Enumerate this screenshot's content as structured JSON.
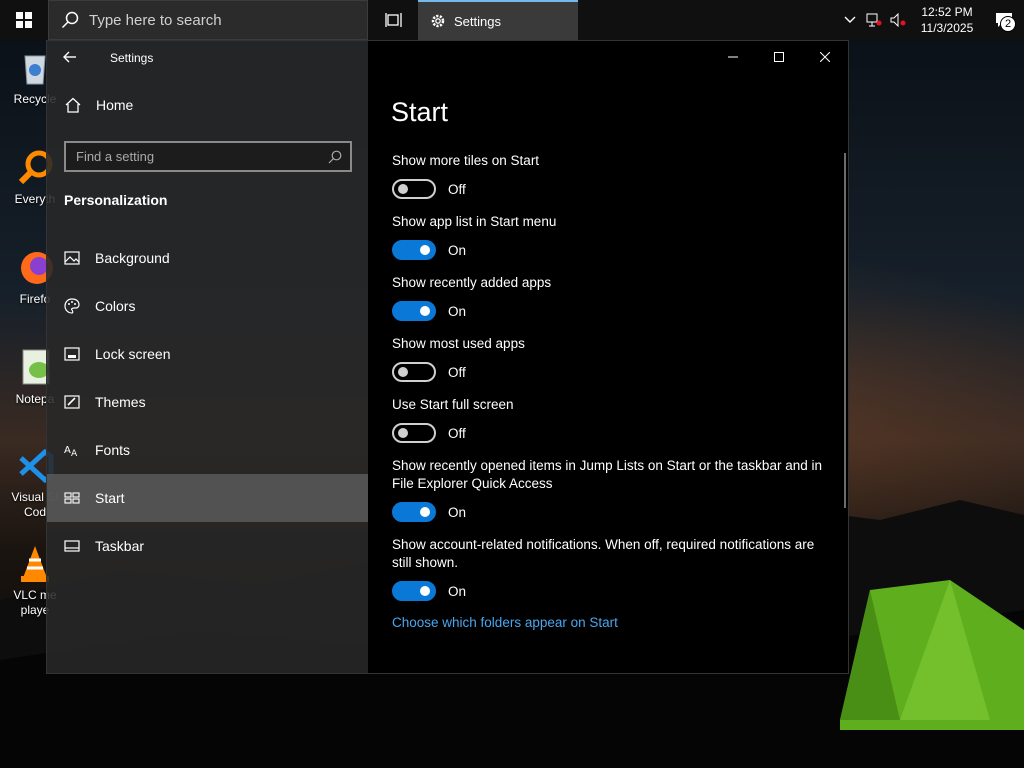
{
  "taskbar": {
    "search_placeholder": "Type here to search",
    "active_app": "Settings",
    "clock_time": "12:52 PM",
    "clock_date": "11/3/2025",
    "notification_count": "2"
  },
  "desktop_icons": [
    {
      "label": "Recycle",
      "icon": "recycle-bin-icon"
    },
    {
      "label": "Everyth",
      "icon": "everything-search-icon"
    },
    {
      "label": "Firefo",
      "icon": "firefox-icon"
    },
    {
      "label": "Notepa",
      "icon": "notepad-plus-plus-icon"
    },
    {
      "label": "Visual St",
      "label2": "Cod",
      "icon": "vscode-icon"
    },
    {
      "label": "VLC me",
      "label2": "playe",
      "icon": "vlc-icon"
    }
  ],
  "window": {
    "title": "Settings",
    "sidebar": {
      "home_label": "Home",
      "find_placeholder": "Find a setting",
      "section": "Personalization",
      "items": [
        {
          "label": "Background",
          "icon": "picture-icon"
        },
        {
          "label": "Colors",
          "icon": "palette-icon"
        },
        {
          "label": "Lock screen",
          "icon": "lock-screen-icon"
        },
        {
          "label": "Themes",
          "icon": "themes-icon"
        },
        {
          "label": "Fonts",
          "icon": "fonts-icon"
        },
        {
          "label": "Start",
          "icon": "start-tiles-icon",
          "active": true
        },
        {
          "label": "Taskbar",
          "icon": "taskbar-icon"
        }
      ]
    },
    "main": {
      "title": "Start",
      "settings": [
        {
          "label": "Show more tiles on Start",
          "state": "Off",
          "on": false
        },
        {
          "label": "Show app list in Start menu",
          "state": "On",
          "on": true
        },
        {
          "label": "Show recently added apps",
          "state": "On",
          "on": true
        },
        {
          "label": "Show most used apps",
          "state": "Off",
          "on": false
        },
        {
          "label": "Use Start full screen",
          "state": "Off",
          "on": false
        },
        {
          "label": "Show recently opened items in Jump Lists on Start or the taskbar and in File Explorer Quick Access",
          "state": "On",
          "on": true
        },
        {
          "label": "Show account-related notifications. When off, required notifications are still shown.",
          "state": "On",
          "on": true
        }
      ],
      "link": "Choose which folders appear on Start"
    }
  },
  "colors": {
    "accent": "#0a78d7",
    "link": "#4aa6ef"
  }
}
